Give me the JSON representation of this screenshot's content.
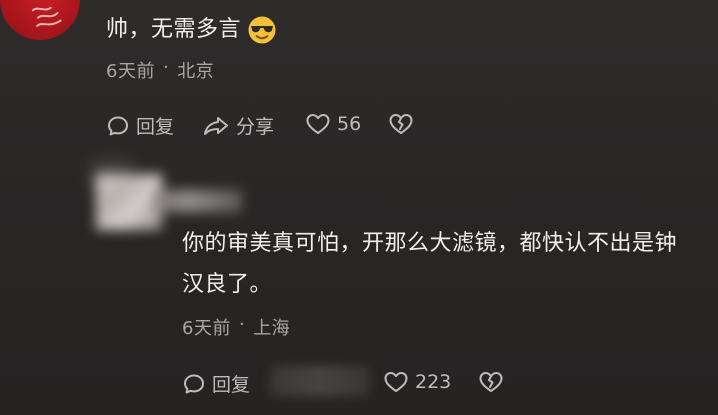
{
  "comment1": {
    "text": "帅，无需多言",
    "emoji": "sunglasses-emoji",
    "time": "6天前",
    "separator": "·",
    "location": "北京",
    "actions": {
      "reply_label": "回复",
      "share_label": "分享",
      "like_count": "56"
    }
  },
  "comment2": {
    "text_line1": "你的审美真可怕，开那么大滤镜，都快认不出是钟",
    "text_line2": "汉良了。",
    "time": "6天前",
    "separator": "·",
    "location": "上海",
    "actions": {
      "reply_label": "回复",
      "like_count": "223"
    }
  },
  "colors": {
    "background": "#2a2827",
    "text": "#f1f0ef",
    "meta": "#a9a7a5",
    "icon": "#bfbdbb",
    "avatar_red": "#c81e24"
  }
}
